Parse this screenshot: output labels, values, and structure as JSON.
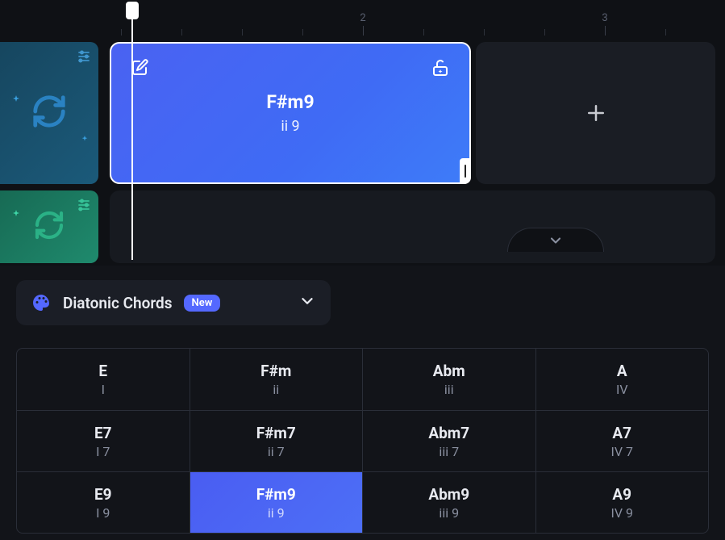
{
  "ruler": {
    "markers": [
      "2",
      "3"
    ]
  },
  "selected_chord": {
    "name": "F#m9",
    "degree": "ii 9"
  },
  "panel": {
    "title": "Diatonic Chords",
    "badge": "New"
  },
  "grid": [
    [
      {
        "name": "E",
        "degree": "I"
      },
      {
        "name": "F#m",
        "degree": "ii"
      },
      {
        "name": "Abm",
        "degree": "iii"
      },
      {
        "name": "A",
        "degree": "IV"
      }
    ],
    [
      {
        "name": "E7",
        "degree": "I 7"
      },
      {
        "name": "F#m7",
        "degree": "ii 7"
      },
      {
        "name": "Abm7",
        "degree": "iii 7"
      },
      {
        "name": "A7",
        "degree": "IV 7"
      }
    ],
    [
      {
        "name": "E9",
        "degree": "I 9"
      },
      {
        "name": "F#m9",
        "degree": "ii 9",
        "active": true
      },
      {
        "name": "Abm9",
        "degree": "iii 9"
      },
      {
        "name": "A9",
        "degree": "IV 9"
      }
    ]
  ]
}
